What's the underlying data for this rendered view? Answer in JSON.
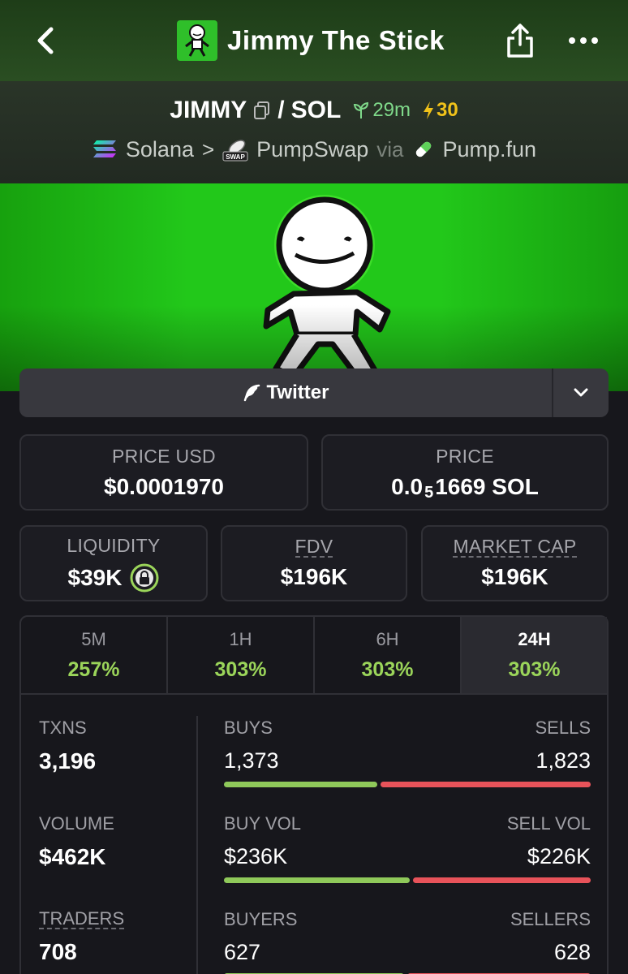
{
  "header": {
    "title": "Jimmy The Stick",
    "back_icon": "chevron-left-icon",
    "share_icon": "share-icon",
    "more_icon": "more-horizontal-icon"
  },
  "pair": {
    "base": "JIMMY",
    "separator": "/",
    "quote": "SOL",
    "age": "29m",
    "boost": "30",
    "chain": "Solana",
    "dex": "PumpSwap",
    "via": "via",
    "launchpad": "Pump.fun"
  },
  "social": {
    "twitter_label": "Twitter"
  },
  "price": {
    "usd_label": "PRICE USD",
    "usd_value": "$0.0001970",
    "native_label": "PRICE",
    "native_prefix": "0.0",
    "native_zeros": "5",
    "native_suffix": "1669 SOL"
  },
  "metrics": {
    "liquidity_label": "LIQUIDITY",
    "liquidity_value": "$39K",
    "fdv_label": "FDV",
    "fdv_value": "$196K",
    "mcap_label": "MARKET CAP",
    "mcap_value": "$196K"
  },
  "timeframes": [
    {
      "label": "5M",
      "change": "257%"
    },
    {
      "label": "1H",
      "change": "303%"
    },
    {
      "label": "6H",
      "change": "303%"
    },
    {
      "label": "24H",
      "change": "303%",
      "active": true
    }
  ],
  "stats": {
    "txns_label": "TXNS",
    "txns_value": "3,196",
    "buys_label": "BUYS",
    "buys_value": "1,373",
    "sells_label": "SELLS",
    "sells_value": "1,823",
    "volume_label": "VOLUME",
    "volume_value": "$462K",
    "buy_vol_label": "BUY VOL",
    "buy_vol_value": "$236K",
    "sell_vol_label": "SELL VOL",
    "sell_vol_value": "$226K",
    "traders_label": "TRADERS",
    "traders_value": "708",
    "buyers_label": "BUYERS",
    "buyers_value": "627",
    "sellers_label": "SELLERS",
    "sellers_value": "628"
  },
  "colors": {
    "positive": "#9bd55a",
    "buy_bar": "#8fc95a",
    "sell_bar": "#e8535a",
    "boost": "#f0c21a",
    "banner": "#22c81a"
  }
}
